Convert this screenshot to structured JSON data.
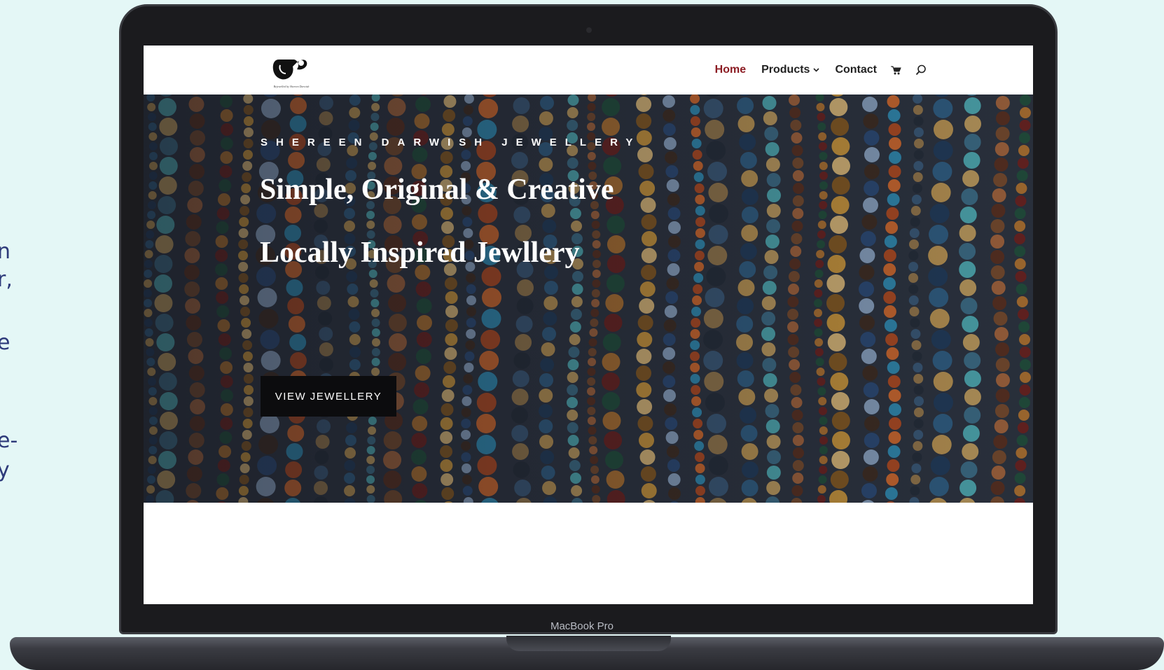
{
  "side_text": [
    "n",
    "r,",
    "e",
    "e-",
    "y"
  ],
  "device": {
    "label": "MacBook Pro"
  },
  "site": {
    "logo_caption": "Bejewelled by Shereen Darwish",
    "nav": {
      "items": [
        {
          "label": "Home",
          "active": true
        },
        {
          "label": "Products",
          "has_dropdown": true
        },
        {
          "label": "Contact"
        }
      ],
      "icons": [
        "cart-icon",
        "search-icon"
      ],
      "active_color": "#8c1d24"
    },
    "hero": {
      "eyebrow": "SHEREEN DARWISH JEWELLERY",
      "title_line1": "Simple, Original & Creative",
      "title_line2": "Locally Inspired Jewllery",
      "button_label": "VIEW JEWELLERY",
      "slides_total": 2,
      "slide_active": 1
    }
  }
}
